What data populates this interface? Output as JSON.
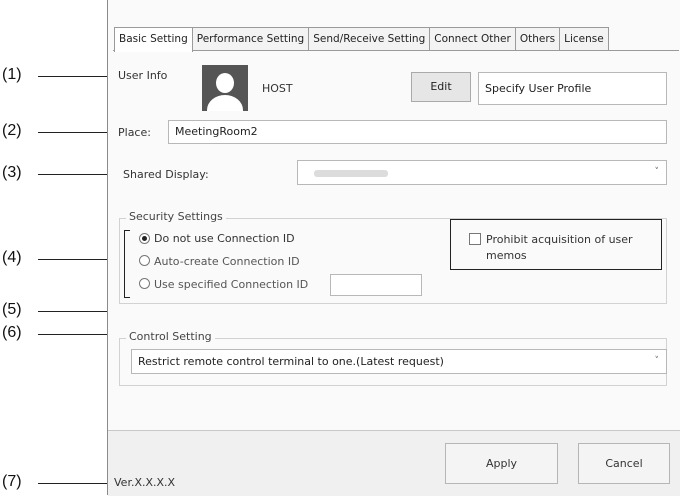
{
  "tabs": [
    "Basic Setting",
    "Performance Setting",
    "Send/Receive Setting",
    "Connect Other",
    "Others",
    "License"
  ],
  "callouts": [
    "(1)",
    "(2)",
    "(3)",
    "(4)",
    "(5)",
    "(6)",
    "(7)"
  ],
  "user_info": {
    "label": "User Info",
    "name": "HOST",
    "edit_button": "Edit",
    "profile_field": "Specify User Profile"
  },
  "place": {
    "label": "Place:",
    "value": "MeetingRoom2"
  },
  "shared_display": {
    "label": "Shared Display:",
    "value": "",
    "chevron": "˅"
  },
  "security": {
    "title": "Security Settings",
    "options": [
      "Do not use Connection ID",
      "Auto-create Connection ID",
      "Use specified Connection ID"
    ],
    "selected_index": 0,
    "connection_id_value": "",
    "prohibit_label": "Prohibit acquisition of user memos",
    "prohibit_checked": false
  },
  "control": {
    "title": "Control Setting",
    "value": "Restrict remote control terminal to one.(Latest request)",
    "chevron": "˅"
  },
  "footer": {
    "version": "Ver.X.X.X.X",
    "apply": "Apply",
    "cancel": "Cancel"
  }
}
